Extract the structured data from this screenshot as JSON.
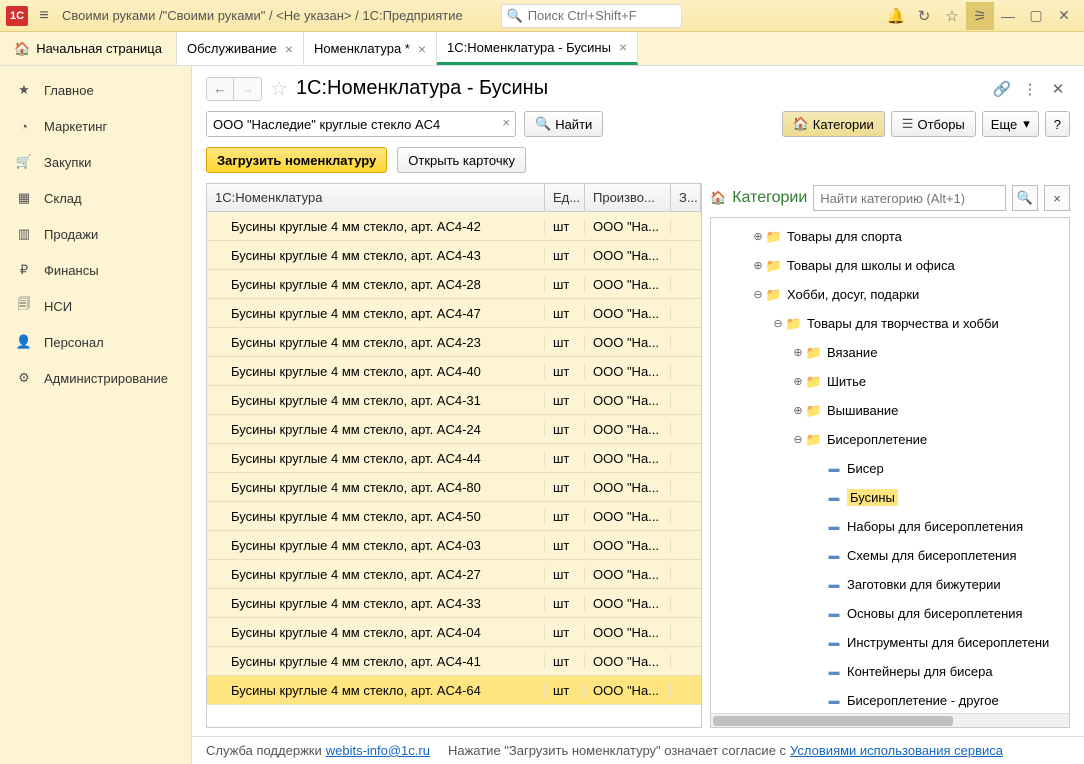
{
  "titlebar": {
    "title": "Своими руками /\"Своими руками\" / <Не указан> / 1С:Предприятие",
    "search_placeholder": "Поиск Ctrl+Shift+F"
  },
  "tabs": {
    "home": "Начальная страница",
    "items": [
      {
        "label": "Обслуживание",
        "active": false
      },
      {
        "label": "Номенклатура *",
        "active": false
      },
      {
        "label": "1С:Номенклатура - Бусины",
        "active": true
      }
    ]
  },
  "sidebar": [
    {
      "icon": "★",
      "label": "Главное"
    },
    {
      "icon": "◔",
      "label": "Маркетинг"
    },
    {
      "icon": "🛒",
      "label": "Закупки"
    },
    {
      "icon": "▦",
      "label": "Склад"
    },
    {
      "icon": "▥",
      "label": "Продажи"
    },
    {
      "icon": "₽",
      "label": "Финансы"
    },
    {
      "icon": "🗐",
      "label": "НСИ"
    },
    {
      "icon": "👤",
      "label": "Персонал"
    },
    {
      "icon": "⚙",
      "label": "Администрирование"
    }
  ],
  "page": {
    "title": "1С:Номенклатура - Бусины",
    "search_value": "ООО \"Наследие\" круглые стекло AC4",
    "find_btn": "Найти",
    "categories_btn": "Категории",
    "filters_btn": "Отборы",
    "more_btn": "Еще",
    "load_btn": "Загрузить номенклатуру",
    "open_card_btn": "Открыть карточку"
  },
  "table": {
    "headers": {
      "name": "1С:Номенклатура",
      "unit": "Ед...",
      "producer": "Произво...",
      "last": "З..."
    },
    "rows": [
      {
        "name": "Бусины круглые 4 мм стекло, арт. AC4-42",
        "unit": "шт",
        "producer": "ООО \"На..."
      },
      {
        "name": "Бусины круглые 4 мм стекло, арт. AC4-43",
        "unit": "шт",
        "producer": "ООО \"На..."
      },
      {
        "name": "Бусины круглые 4 мм стекло, арт. AC4-28",
        "unit": "шт",
        "producer": "ООО \"На..."
      },
      {
        "name": "Бусины круглые 4 мм стекло, арт. AC4-47",
        "unit": "шт",
        "producer": "ООО \"На..."
      },
      {
        "name": "Бусины круглые 4 мм стекло, арт. AC4-23",
        "unit": "шт",
        "producer": "ООО \"На..."
      },
      {
        "name": "Бусины круглые 4 мм стекло, арт. AC4-40",
        "unit": "шт",
        "producer": "ООО \"На..."
      },
      {
        "name": "Бусины круглые 4 мм стекло, арт. AC4-31",
        "unit": "шт",
        "producer": "ООО \"На..."
      },
      {
        "name": "Бусины круглые 4 мм стекло, арт. AC4-24",
        "unit": "шт",
        "producer": "ООО \"На..."
      },
      {
        "name": "Бусины круглые 4 мм стекло, арт. AC4-44",
        "unit": "шт",
        "producer": "ООО \"На..."
      },
      {
        "name": "Бусины круглые 4 мм стекло, арт. AC4-80",
        "unit": "шт",
        "producer": "ООО \"На..."
      },
      {
        "name": "Бусины круглые 4 мм стекло, арт. AC4-50",
        "unit": "шт",
        "producer": "ООО \"На..."
      },
      {
        "name": "Бусины круглые 4 мм стекло, арт. AC4-03",
        "unit": "шт",
        "producer": "ООО \"На..."
      },
      {
        "name": "Бусины круглые 4 мм стекло, арт. AC4-27",
        "unit": "шт",
        "producer": "ООО \"На..."
      },
      {
        "name": "Бусины круглые 4 мм стекло, арт. AC4-33",
        "unit": "шт",
        "producer": "ООО \"На..."
      },
      {
        "name": "Бусины круглые 4 мм стекло, арт. AC4-04",
        "unit": "шт",
        "producer": "ООО \"На..."
      },
      {
        "name": "Бусины круглые 4 мм стекло, арт. AC4-41",
        "unit": "шт",
        "producer": "ООО \"На..."
      },
      {
        "name": "Бусины круглые 4 мм стекло, арт. AC4-64",
        "unit": "шт",
        "producer": "ООО \"На...",
        "selected": true
      }
    ]
  },
  "categories": {
    "title": "Категории",
    "search_placeholder": "Найти категорию (Alt+1)",
    "tree": [
      {
        "indent": 2,
        "exp": "⊕",
        "type": "folder",
        "label": "Товары для спорта"
      },
      {
        "indent": 2,
        "exp": "⊕",
        "type": "folder",
        "label": "Товары для школы и офиса"
      },
      {
        "indent": 2,
        "exp": "⊖",
        "type": "folder",
        "label": "Хобби, досуг, подарки"
      },
      {
        "indent": 3,
        "exp": "⊖",
        "type": "folder",
        "label": "Товары для творчества и хобби"
      },
      {
        "indent": 4,
        "exp": "⊕",
        "type": "folder",
        "label": "Вязание"
      },
      {
        "indent": 4,
        "exp": "⊕",
        "type": "folder",
        "label": "Шитье"
      },
      {
        "indent": 4,
        "exp": "⊕",
        "type": "folder",
        "label": "Вышивание"
      },
      {
        "indent": 4,
        "exp": "⊖",
        "type": "folder",
        "label": "Бисероплетение"
      },
      {
        "indent": 5,
        "exp": "",
        "type": "item",
        "label": "Бисер"
      },
      {
        "indent": 5,
        "exp": "",
        "type": "item",
        "label": "Бусины",
        "selected": true
      },
      {
        "indent": 5,
        "exp": "",
        "type": "item",
        "label": "Наборы для бисероплетения"
      },
      {
        "indent": 5,
        "exp": "",
        "type": "item",
        "label": "Схемы для бисероплетения"
      },
      {
        "indent": 5,
        "exp": "",
        "type": "item",
        "label": "Заготовки для бижутерии"
      },
      {
        "indent": 5,
        "exp": "",
        "type": "item",
        "label": "Основы для бисероплетения"
      },
      {
        "indent": 5,
        "exp": "",
        "type": "item",
        "label": "Инструменты для бисероплетени"
      },
      {
        "indent": 5,
        "exp": "",
        "type": "item",
        "label": "Контейнеры для бисера"
      },
      {
        "indent": 5,
        "exp": "",
        "type": "item",
        "label": "Бисероплетение - другое"
      }
    ]
  },
  "footer": {
    "support_label": "Служба поддержки",
    "support_link": "webits-info@1c.ru",
    "agree_text": "Нажатие \"Загрузить номенклатуру\" означает согласие с",
    "terms_link": "Условиями использования сервиса"
  }
}
